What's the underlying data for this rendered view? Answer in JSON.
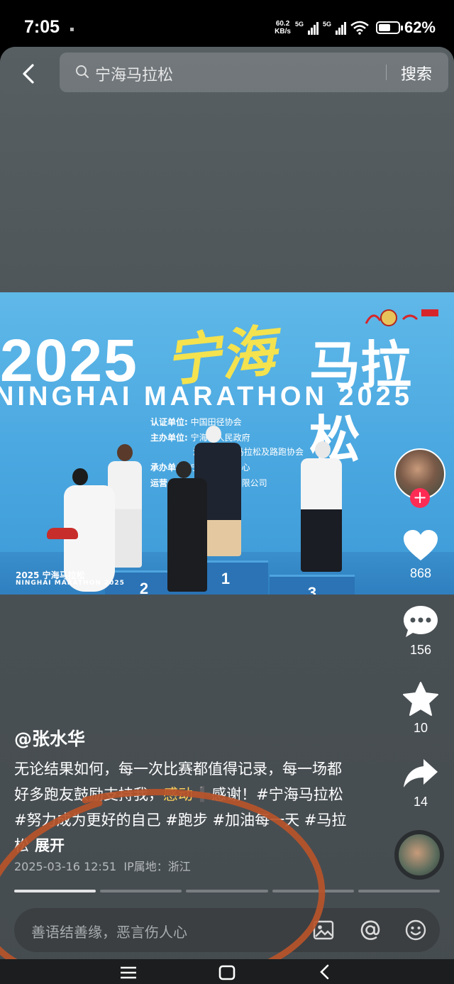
{
  "status_bar": {
    "time": "7:05",
    "net_speed_value": "60.2",
    "net_speed_unit": "KB/s",
    "signal1_label": "5G",
    "signal2_label": "5G",
    "battery_percent": "62%",
    "battery_level": 0.62
  },
  "search": {
    "query": "宁海马拉松",
    "button_label": "搜索"
  },
  "photo": {
    "year": "2025",
    "title_calligraphy": "宁海",
    "title_main": "马拉松",
    "english_title": "NINGHAI MARATHON 2025",
    "org_lines": [
      {
        "label": "认证单位:",
        "value": "中国田径协会"
      },
      {
        "label": "主办单位:",
        "value": "宁海县人民政府"
      },
      {
        "label": "",
        "value": "浙江省田径马拉松及路跑协会"
      },
      {
        "label": "承办单位:",
        "value": "宁海县发展中心"
      },
      {
        "label": "运营:",
        "value": "宁海县体育发展有限公司"
      }
    ],
    "podium_numbers": [
      "1",
      "2",
      "3"
    ],
    "logo_text": "2025 宁海马拉松",
    "logo_sub": "NINGHAI MARATHON 2025"
  },
  "actions": {
    "likes": "868",
    "comments": "156",
    "favorites": "10",
    "shares": "14"
  },
  "post": {
    "author": "@张水华",
    "caption_part1": "无论结果如何，每一次比赛都值得记录，每一场都好多跑友鼓励支持我，",
    "caption_highlight": "感动",
    "caption_emoji": "➕",
    "caption_part2": "感谢！#宁海马拉松 #努力成为更好的自己 #跑步 #加油每一天 #马拉松",
    "expand_label": "展开",
    "date": "2025-03-16 12:51",
    "ip_location": "IP属地：浙江",
    "progress_segments": 5,
    "progress_active": 0
  },
  "comment_bar": {
    "placeholder": "善语结善缘，恶言伤人心"
  },
  "colors": {
    "accent_follow": "#fe2c55",
    "hand_drawn_ring": "#b8542a",
    "hashtag_highlight": "#ffd35c"
  },
  "icons": [
    "back-arrow-icon",
    "search-icon",
    "heart-icon",
    "comment-icon",
    "star-icon",
    "share-icon",
    "image-icon",
    "at-icon",
    "emoji-icon",
    "nav-menu-icon",
    "nav-home-icon",
    "nav-back-icon"
  ]
}
